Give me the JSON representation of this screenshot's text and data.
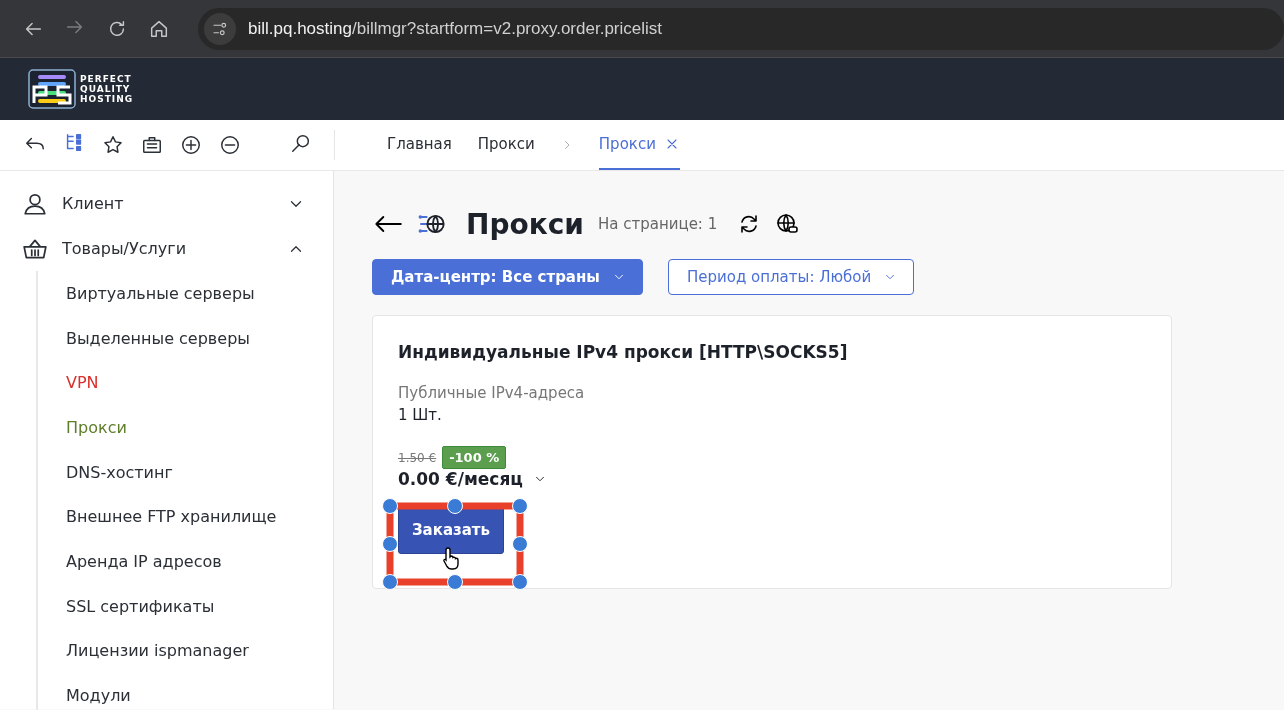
{
  "browser": {
    "url_host": "bill.pq.hosting",
    "url_path": "/billmgr?startform=v2.proxy.order.pricelist"
  },
  "logo": {
    "lines": [
      "PERFECT",
      "QUALITY",
      "HOSTING"
    ]
  },
  "breadcrumbs": [
    {
      "label": "Главная",
      "selected": false
    },
    {
      "label": "Прокси",
      "selected": false
    },
    {
      "label": "Прокси",
      "selected": true
    }
  ],
  "sidebar": [
    {
      "label": "Клиент",
      "expanded": false
    },
    {
      "label": "Товары/Услуги",
      "expanded": true,
      "children": [
        {
          "label": "Виртуальные серверы",
          "color": "#2b2f36"
        },
        {
          "label": "Выделенные серверы",
          "color": "#2b2f36"
        },
        {
          "label": "VPN",
          "color": "#d9302c"
        },
        {
          "label": "Прокси",
          "color": "#5e7d2a"
        },
        {
          "label": "DNS-хостинг",
          "color": "#2b2f36"
        },
        {
          "label": "Внешнее FTP хранилище",
          "color": "#2b2f36"
        },
        {
          "label": "Аренда IP адресов",
          "color": "#2b2f36"
        },
        {
          "label": "SSL сертификаты",
          "color": "#2b2f36"
        },
        {
          "label": "Лицензии ispmanager",
          "color": "#2b2f36"
        },
        {
          "label": "Модули",
          "color": "#2b2f36"
        }
      ]
    }
  ],
  "page": {
    "title": "Прокси",
    "per_page": "На странице: 1"
  },
  "filters": [
    {
      "label": "Дата-центр: Все страны",
      "active": true
    },
    {
      "label": "Период оплаты: Любой",
      "active": false
    }
  ],
  "card": {
    "title": "Индивидуальные IPv4 прокси [HTTP\\SOCKS5]",
    "subtitle": "Публичные IPv4-адреса",
    "quantity": "1 Шт.",
    "old_price": "1.50 €",
    "discount": "-100 %",
    "price": "0.00 €/месяц",
    "button": "Заказать",
    "highlighted": true
  }
}
